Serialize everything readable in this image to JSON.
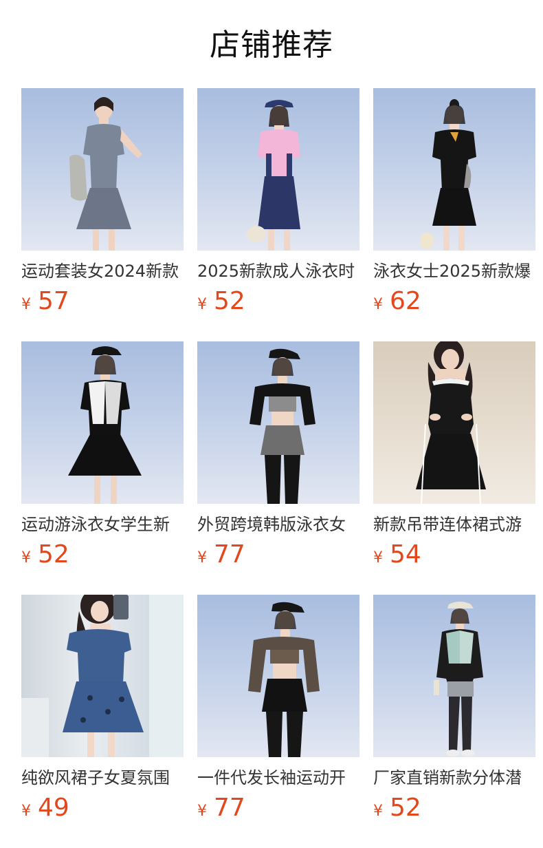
{
  "header": {
    "title": "店铺推荐"
  },
  "currency_symbol": "¥",
  "products": [
    {
      "name": "运动套装女2024新款",
      "price": "57",
      "image": "woman-gray-sport-swim-dress"
    },
    {
      "name": "2025新款成人泳衣时",
      "price": "52",
      "image": "woman-pink-navy-swim-dress"
    },
    {
      "name": "泳衣女士2025新款爆",
      "price": "62",
      "image": "woman-black-qipao-swim-dress"
    },
    {
      "name": "运动游泳衣女学生新",
      "price": "52",
      "image": "woman-black-white-swim-dress"
    },
    {
      "name": "外贸跨境韩版泳衣女",
      "price": "77",
      "image": "woman-zebra-print-swim-set"
    },
    {
      "name": "新款吊带连体裙式游",
      "price": "54",
      "image": "woman-black-halter-swim-dress"
    },
    {
      "name": "纯欲风裙子女夏氛围",
      "price": "49",
      "image": "woman-blue-floral-swim-dress"
    },
    {
      "name": "一件代发长袖运动开",
      "price": "77",
      "image": "woman-camo-swim-set"
    },
    {
      "name": "厂家直销新款分体潜",
      "price": "52",
      "image": "woman-long-sleeve-dive-suit"
    }
  ],
  "colors": {
    "price": "#e4471b",
    "title": "#111111",
    "text": "#333333"
  }
}
